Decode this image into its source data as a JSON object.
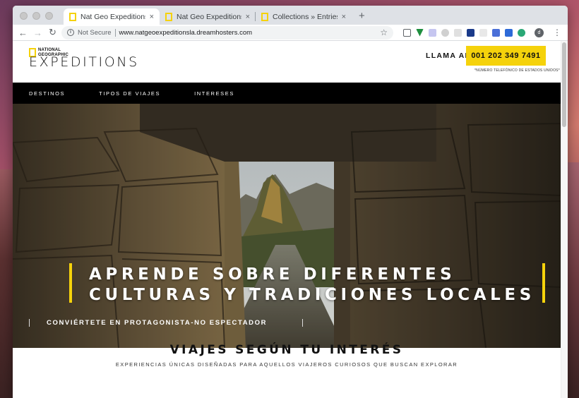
{
  "browser": {
    "tabs": [
      {
        "title": "Nat Geo Expeditions",
        "close": "×",
        "active": true
      },
      {
        "title": "Nat Geo Expeditions",
        "close": "×",
        "active": false
      },
      {
        "title": "Collections » Entries » Highlig",
        "close": "×",
        "active": false
      }
    ],
    "new_tab": "+",
    "security_label": "Not Secure",
    "url": "www.natgeoexpeditionsla.dreamhosters.com",
    "profile_initial": "d"
  },
  "site": {
    "logo_text": "NATIONAL GEOGRAPHIC",
    "brand": "EXPEDITIONS",
    "call_label": "LLAMA AL",
    "phone": "001 202 349 7491",
    "phone_note": "*NÚMERO TELEFÓNICO DE ESTADOS UNIDOS*",
    "accent": "#f5d20b",
    "nav": [
      "DESTINOS",
      "TIPOS DE VIAJES",
      "INTERESES"
    ]
  },
  "hero": {
    "title_line1": "APRENDE SOBRE DIFERENTES",
    "title_line2": "CULTURAS Y TRADICIONES LOCALES",
    "subtitle": "CONVIÉRTETE EN PROTAGONISTA-NO ESPECTADOR"
  },
  "section": {
    "title": "VIAJES SEGÚN TU INTERÉS",
    "subtitle": "EXPERIENCIAS ÚNICAS DISEÑADAS PARA AQUELLOS VIAJEROS CURIOSOS QUE BUSCAN EXPLORAR"
  }
}
